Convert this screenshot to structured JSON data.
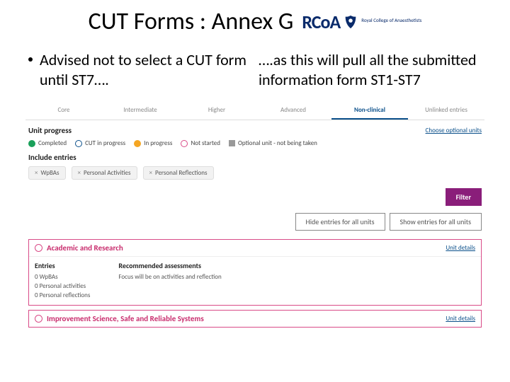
{
  "title": "CUT Forms : Annex G",
  "logo": {
    "text": "RCoA",
    "sub": "Royal College of Anaesthetists"
  },
  "bullets": {
    "left": "Advised not to select a CUT form until ST7….",
    "right": "….as this will pull all the submitted information form ST1-ST7"
  },
  "tabs": [
    "Core",
    "Intermediate",
    "Higher",
    "Advanced",
    "Non-clinical",
    "Unlinked entries"
  ],
  "active_tab": "Non-clinical",
  "unit_progress_label": "Unit progress",
  "choose_units": "Choose optional units",
  "legend": {
    "completed": "Completed",
    "cut": "CUT in progress",
    "inprog": "In progress",
    "notstarted": "Not started",
    "optional": "Optional unit - not being taken"
  },
  "include_label": "Include entries",
  "chips": [
    "WpBAs",
    "Personal Activities",
    "Personal Reflections"
  ],
  "filter_btn": "Filter",
  "hide_btn": "Hide entries for all units",
  "show_btn": "Show entries for all units",
  "panel1": {
    "title": "Academic and Research",
    "unit_details": "Unit details",
    "entries_h": "Entries",
    "entries": [
      "0 WpBAs",
      "0 Personal activities",
      "0 Personal reflections"
    ],
    "rec_h": "Recommended assessments",
    "rec": "Focus will be on activities and reflection"
  },
  "panel2": {
    "title": "Improvement Science, Safe and Reliable Systems",
    "unit_details": "Unit details"
  }
}
